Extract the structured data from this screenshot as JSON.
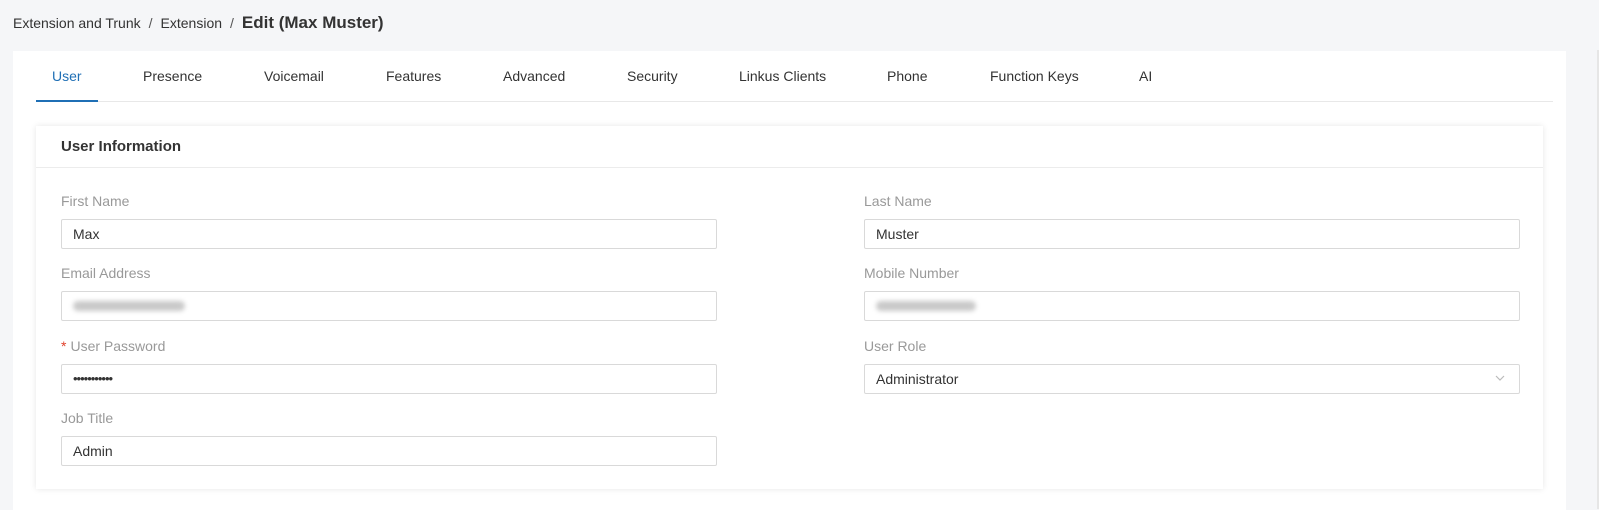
{
  "breadcrumb": {
    "items": [
      "Extension and Trunk",
      "Extension"
    ],
    "separator": "/",
    "current": "Edit (Max Muster)"
  },
  "tabs": [
    "User",
    "Presence",
    "Voicemail",
    "Features",
    "Advanced",
    "Security",
    "Linkus Clients",
    "Phone",
    "Function Keys",
    "AI"
  ],
  "active_tab": "User",
  "section": {
    "title": "User Information",
    "fields": {
      "first_name": {
        "label": "First Name",
        "value": "Max"
      },
      "last_name": {
        "label": "Last Name",
        "value": "Muster"
      },
      "email": {
        "label": "Email Address",
        "value": ""
      },
      "mobile": {
        "label": "Mobile Number",
        "value": ""
      },
      "password": {
        "label": "User Password",
        "required_mark": "*",
        "value": "•••••••••••"
      },
      "user_role": {
        "label": "User Role",
        "value": "Administrator"
      },
      "job_title": {
        "label": "Job Title",
        "value": "Admin"
      }
    }
  },
  "colors": {
    "accent": "#1f6fb5",
    "required": "#e0412b",
    "label": "#999999"
  },
  "icons": {
    "select_arrow": "chevron-down-icon"
  }
}
